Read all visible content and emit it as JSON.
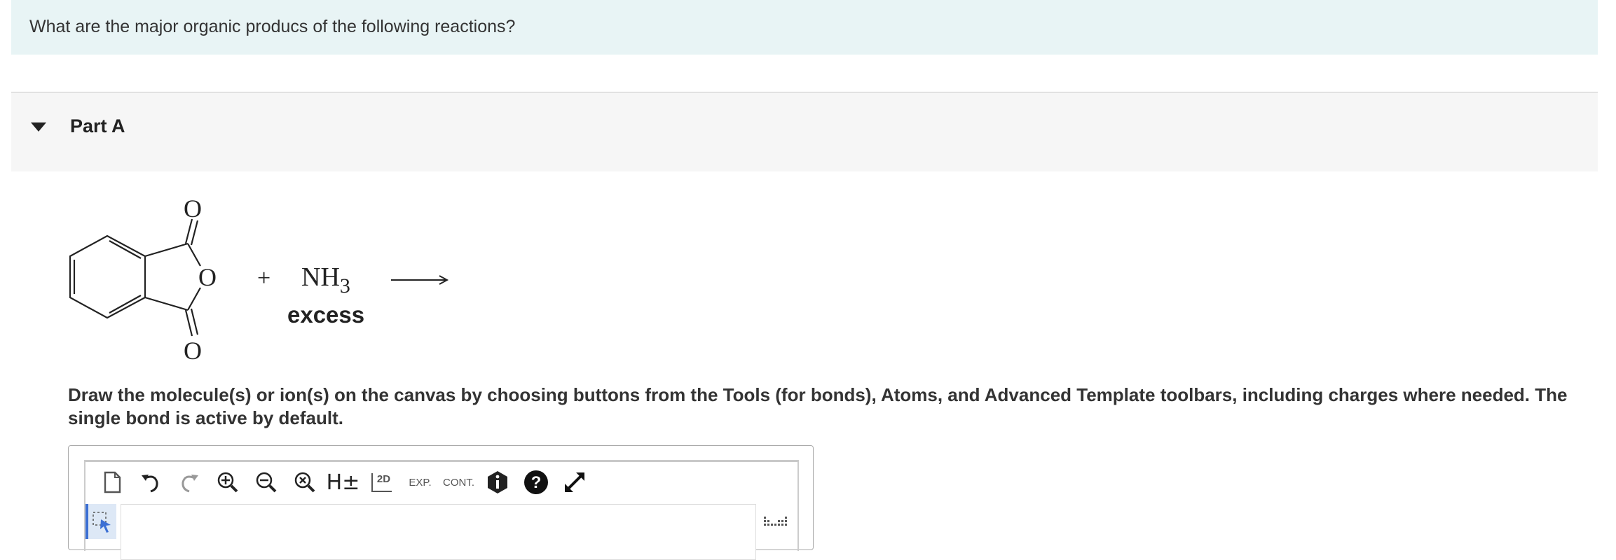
{
  "question": {
    "text": "What are the major organic producs of the following reactions?"
  },
  "part": {
    "title": "Part A"
  },
  "reaction": {
    "carbonyl_o_top": "O",
    "ring_o": "O",
    "carbonyl_o_bottom": "O",
    "plus": "+",
    "reagent": "NH",
    "reagent_subscript": "3",
    "condition": "excess"
  },
  "instructions": {
    "text": "Draw the molecule(s) or ion(s) on the canvas by choosing buttons from the Tools (for bonds), Atoms, and Advanced Template toolbars, including charges where needed. The single bond is active by default."
  },
  "toolbar": {
    "new_icon": "document-icon",
    "undo_icon": "undo-icon",
    "redo_icon": "redo-icon",
    "zoom_in_icon": "zoom-in-icon",
    "zoom_out_icon": "zoom-out-icon",
    "zoom_reset_icon": "zoom-reset-icon",
    "h_toggle_label": "H±",
    "clean_2d_label": "2D",
    "expand_label": "EXP.",
    "contract_label": "CONT.",
    "info_icon": "info-icon",
    "help_icon": "help-icon",
    "fullscreen_icon": "fullscreen-icon"
  }
}
